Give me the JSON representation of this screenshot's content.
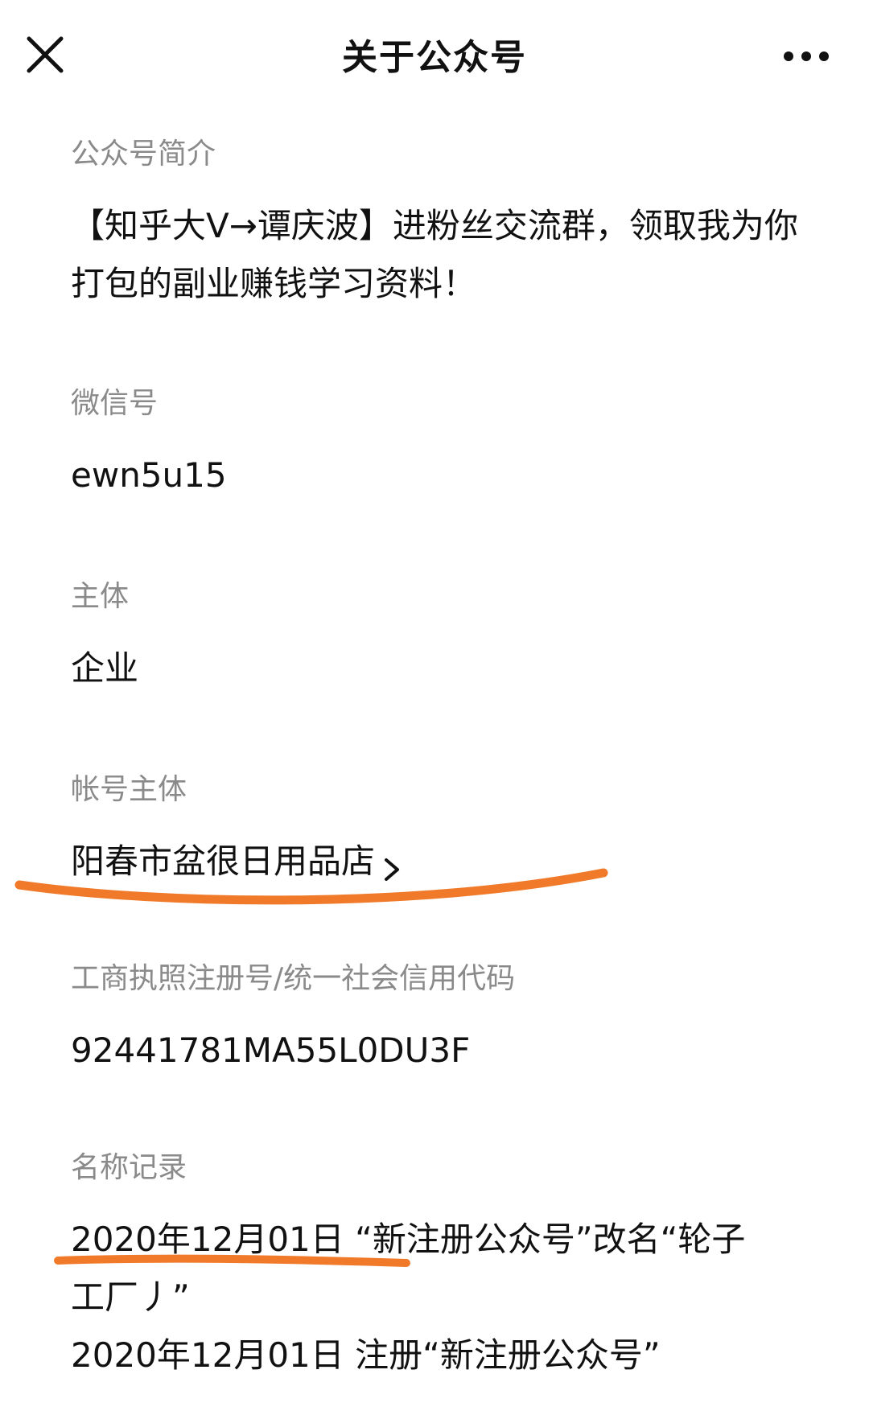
{
  "nav": {
    "title": "关于公众号",
    "close_icon": "close-icon",
    "more_icon": "more-dots-icon"
  },
  "sections": {
    "intro": {
      "label": "公众号简介",
      "value": "【知乎大V→谭庆波】进粉丝交流群，领取我为你打包的副业赚钱学习资料！"
    },
    "wechat_id": {
      "label": "微信号",
      "value": "ewn5u15"
    },
    "entity_type": {
      "label": "主体",
      "value": "企业"
    },
    "account_entity": {
      "label": "帐号主体",
      "value": "阳春市盆很日用品店",
      "chevron_icon": "chevron-right-icon"
    },
    "license": {
      "label": "工商执照注册号/统一社会信用代码",
      "value": "92441781MA55L0DU3F"
    },
    "name_history": {
      "label": "名称记录",
      "records": [
        "2020年12月01日 “新注册公众号”改名“轮子",
        "工厂丿”",
        "2020年12月01日 注册“新注册公众号”"
      ]
    }
  },
  "colors": {
    "label": "#8a8a8a",
    "text": "#111111",
    "annotation": "#f07a2a"
  }
}
